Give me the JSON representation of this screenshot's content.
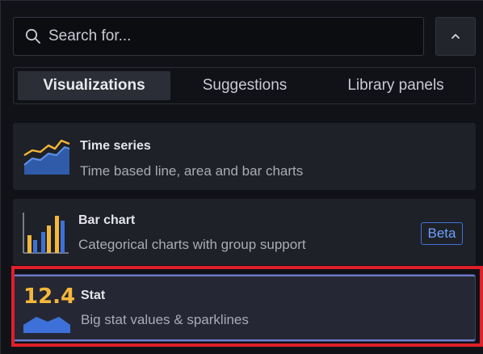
{
  "search": {
    "placeholder": "Search for...",
    "value": ""
  },
  "toolbar": {
    "collapse_icon": "chevron-up-icon"
  },
  "tabs": [
    {
      "label": "Visualizations",
      "active": true
    },
    {
      "label": "Suggestions",
      "active": false
    },
    {
      "label": "Library panels",
      "active": false
    }
  ],
  "visualizations": [
    {
      "title": "Time series",
      "description": "Time based line, area and bar charts",
      "icon": "time-series-icon"
    },
    {
      "title": "Bar chart",
      "description": "Categorical charts with group support",
      "icon": "bar-chart-icon",
      "badge": "Beta"
    },
    {
      "title": "Stat",
      "description": "Big stat values & sparklines",
      "icon": "stat-icon",
      "icon_value": "12.4",
      "selected": true
    }
  ],
  "colors": {
    "accent_yellow": "#f5b73b",
    "accent_blue": "#3d71d9",
    "highlight_red": "#e01f2a",
    "selected_border": "#6e7ccd"
  }
}
